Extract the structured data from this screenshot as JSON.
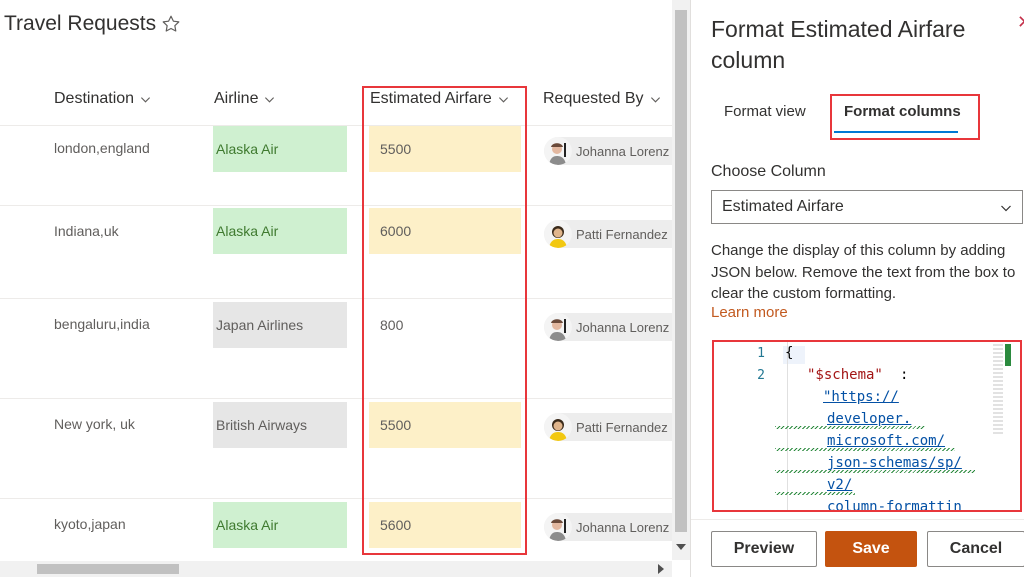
{
  "list": {
    "title": "Travel Requests",
    "favorite_icon": "star-icon",
    "columns": [
      {
        "label": "Destination"
      },
      {
        "label": "Airline"
      },
      {
        "label": "Estimated Airfare"
      },
      {
        "label": "Requested By"
      }
    ],
    "rows": [
      {
        "destination": "london,england",
        "airline": "Alaska Air",
        "airline_style": "green",
        "fare": "5500",
        "fare_style": "yellow",
        "requested_by": "Johanna Lorenz",
        "avatar": "person-avatar-icon"
      },
      {
        "destination": "Indiana,uk",
        "airline": "Alaska Air",
        "airline_style": "green",
        "fare": "6000",
        "fare_style": "yellow",
        "requested_by": "Patti Fernandez",
        "avatar": "person-avatar-icon"
      },
      {
        "destination": "bengaluru,india",
        "airline": "Japan Airlines",
        "airline_style": "gray",
        "fare": "800",
        "fare_style": "none",
        "requested_by": "Johanna Lorenz",
        "avatar": "person-avatar-icon"
      },
      {
        "destination": "New york, uk",
        "airline": "British Airways",
        "airline_style": "gray",
        "fare": "5500",
        "fare_style": "yellow",
        "requested_by": "Patti Fernandez",
        "avatar": "person-avatar-icon"
      },
      {
        "destination": "kyoto,japan",
        "airline": "Alaska Air",
        "airline_style": "green",
        "fare": "5600",
        "fare_style": "yellow",
        "requested_by": "Johanna Lorenz",
        "avatar": "person-avatar-icon"
      }
    ]
  },
  "panel": {
    "title": "Format Estimated Airfare column",
    "close_icon": "close-icon",
    "tabs": [
      {
        "label": "Format view",
        "active": false
      },
      {
        "label": "Format columns",
        "active": true
      }
    ],
    "choose_column_label": "Choose Column",
    "selected_column": "Estimated Airfare",
    "description": "Change the display of this column by adding JSON below. Remove the text from the box to clear the custom formatting.",
    "learn_more": "Learn more",
    "code": {
      "line_numbers": [
        "1",
        "2"
      ],
      "open_brace": "{",
      "schema_key": "\"$schema\"",
      "colon": ":",
      "schema_value_lines": [
        "\"https://",
        "developer.",
        "microsoft.com/",
        "json-schemas/sp/",
        "v2/",
        "column-formattin"
      ]
    },
    "buttons": {
      "preview": "Preview",
      "save": "Save",
      "cancel": "Cancel"
    }
  },
  "colors": {
    "accent_blue": "#0078d4",
    "save_orange": "#c4530f",
    "highlight_red": "#e8363b",
    "airline_green": "#cff0d0",
    "fare_yellow": "#fdf0c8"
  }
}
